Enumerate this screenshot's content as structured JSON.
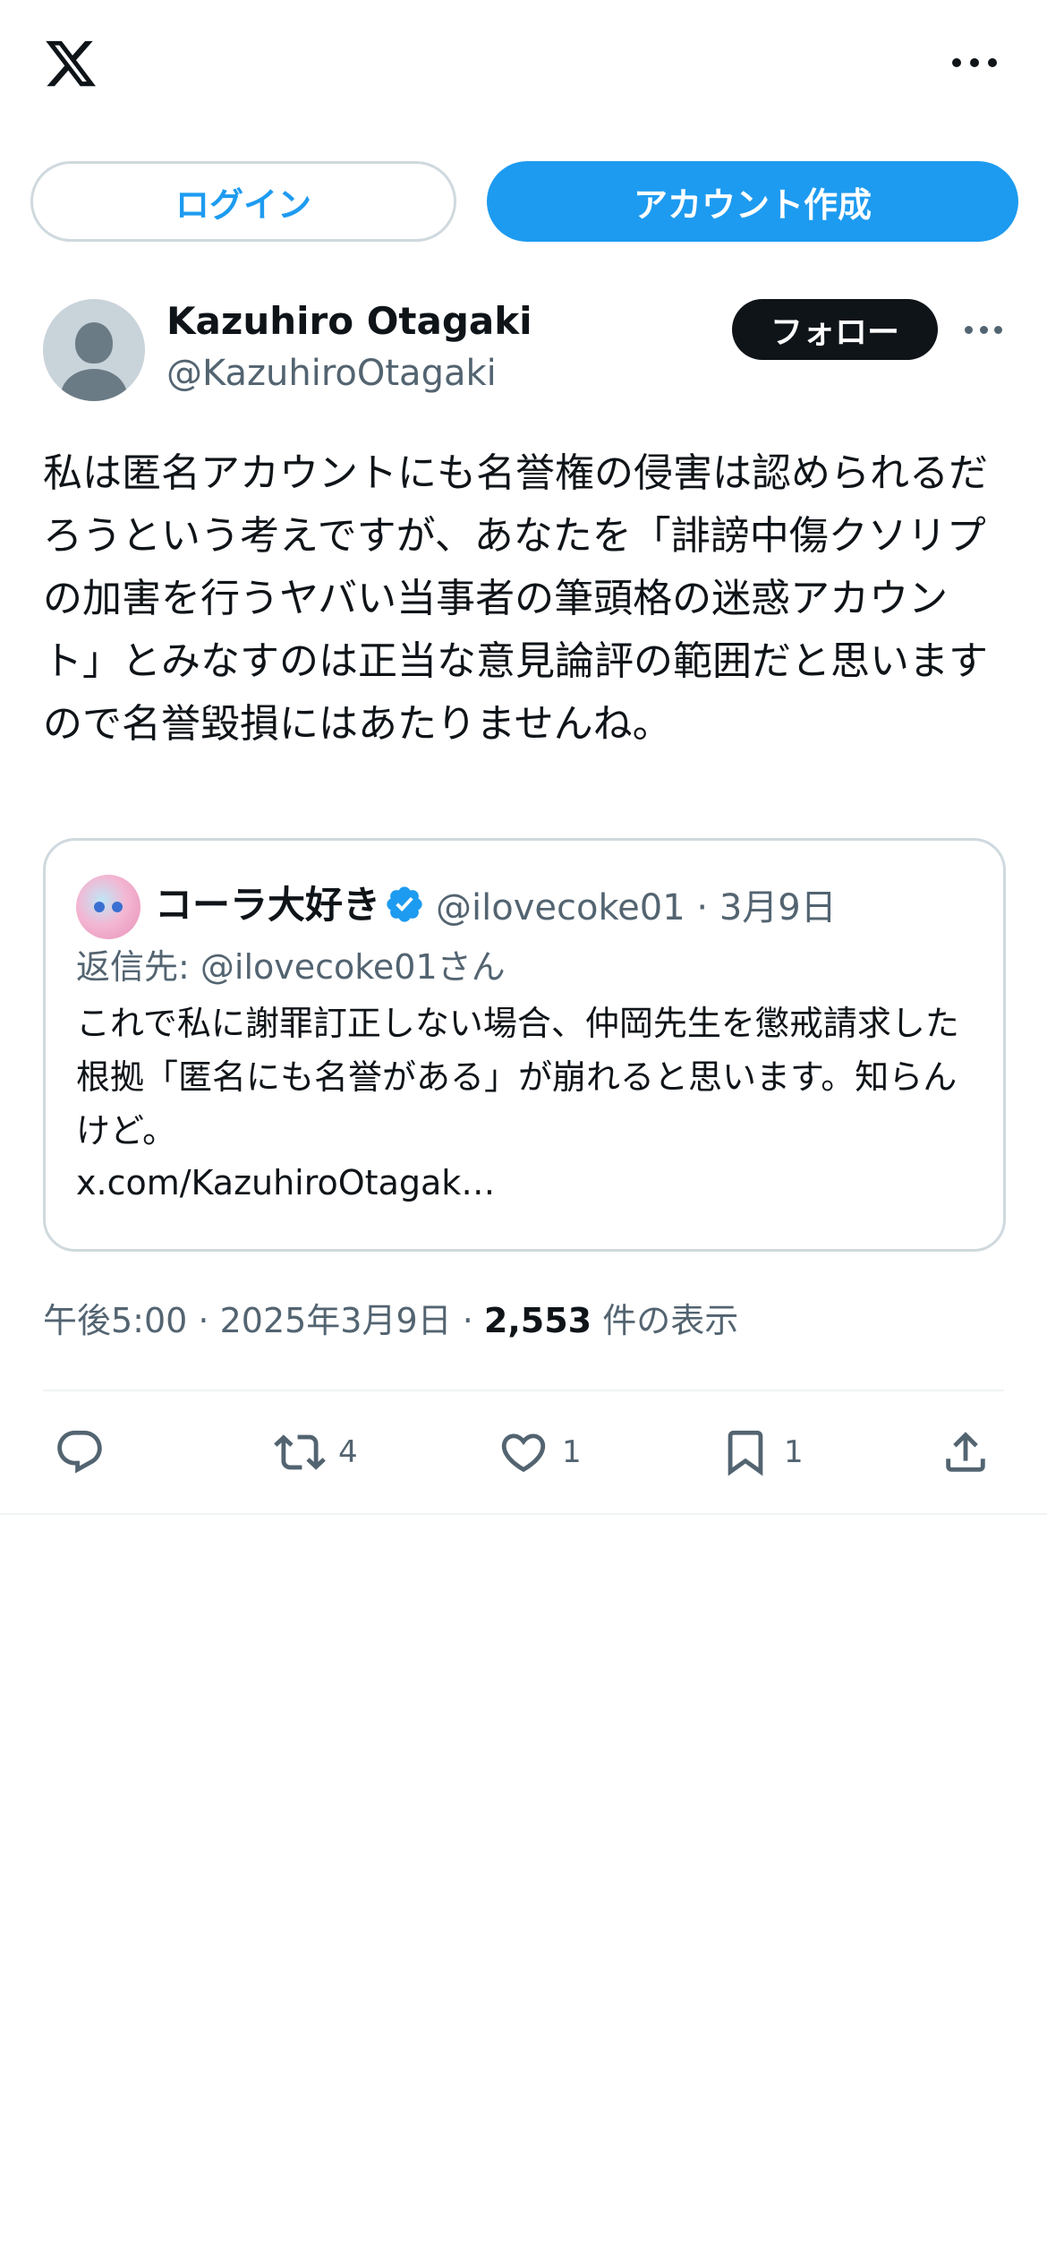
{
  "header": {
    "logo_icon": "x-logo-icon",
    "more_icon": "more-horizontal-icon"
  },
  "auth": {
    "login_label": "ログイン",
    "signup_label": "アカウント作成"
  },
  "tweet": {
    "author_name": "Kazuhiro Otagaki",
    "author_handle": "@KazuhiroOtagaki",
    "follow_label": "フォロー",
    "text": "私は匿名アカウントにも名誉権の侵害は認められるだろうという考えですが、あなたを「誹謗中傷クソリプの加害を行うヤバい当事者の筆頭格の迷惑アカウント」とみなすのは正当な意見論評の範囲だと思いますので名誉毀損にはあたりませんね。",
    "time": "午後5:00",
    "date": "2025年3月9日",
    "views_count": "2,553",
    "views_label": "件の表示"
  },
  "quote": {
    "name": "コーラ大好き",
    "handle": "@ilovecoke01",
    "date": "3月9日",
    "reply_to": "返信先: @ilovecoke01さん",
    "text": "これで私に謝罪訂正しない場合、仲岡先生を懲戒請求した根拠「匿名にも名誉がある」が崩れると思います。知らんけど。",
    "link": "x.com/KazuhiroOtagak…"
  },
  "actions": {
    "reply_count": "",
    "retweet_count": "4",
    "like_count": "1",
    "bookmark_count": "1"
  },
  "colors": {
    "accent": "#1d9bf0",
    "text": "#0f1419",
    "secondary": "#536471",
    "border": "#cfd9de"
  }
}
